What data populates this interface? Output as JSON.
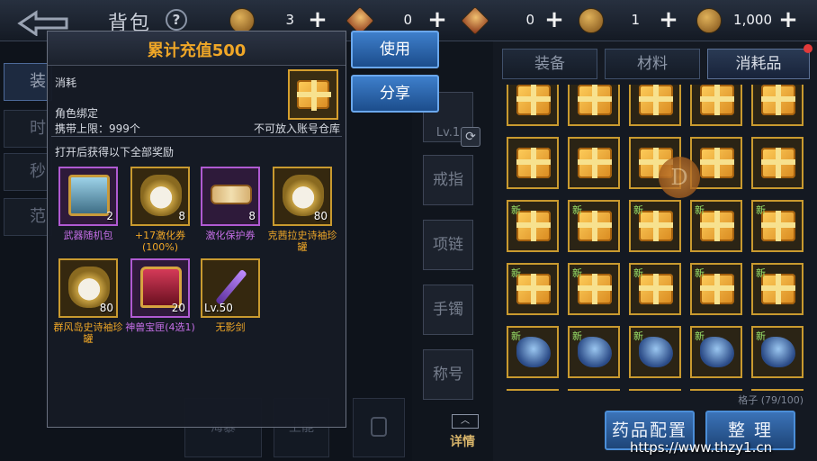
{
  "header": {
    "title": "背包",
    "help": "?"
  },
  "currencies": [
    {
      "icon": "gold-coin-icon",
      "value": "3"
    },
    {
      "icon": "diamond-ticket-icon",
      "value": "0"
    },
    {
      "icon": "scroll-coupon-icon",
      "value": "0"
    },
    {
      "icon": "token-coin-icon",
      "value": "1"
    },
    {
      "icon": "bronze-coin-icon",
      "value": "1,000"
    }
  ],
  "plus": "+",
  "side_tabs": [
    "装",
    "时",
    "秒",
    "范"
  ],
  "inventory": {
    "tabs": [
      "装备",
      "材料",
      "消耗品"
    ],
    "active_tab": "消耗品",
    "capacity": "格子 (79/100)",
    "new_badge": "新",
    "coin_letter": "D",
    "buttons": {
      "medicine": "药品配置",
      "sort": "整 理"
    }
  },
  "equip_slots": [
    "Lv.1",
    "戒指",
    "项链",
    "手镯",
    "称号"
  ],
  "detail_label": "详情",
  "bottom_dim": [
    "海暴",
    "上能",
    ""
  ],
  "actions": {
    "use": "使用",
    "share": "分享"
  },
  "tooltip": {
    "title": "累计充值500",
    "category": "消耗",
    "bind": "角色绑定",
    "stack_limit": "携带上限：999个",
    "warehouse": "不可放入账号仓库",
    "rewards_header": "打开后获得以下全部奖励",
    "rewards": [
      {
        "name": "武器随机包",
        "count": "2",
        "name_color": "#c46ee6",
        "rarity": "purple",
        "art": "chest"
      },
      {
        "name": "+17激化券(100%)",
        "count": "8",
        "name_color": "#f0a727",
        "rarity": "gold",
        "art": "jar"
      },
      {
        "name": "激化保护券",
        "count": "8",
        "name_color": "#c46ee6",
        "rarity": "purple",
        "art": "scroll"
      },
      {
        "name": "克茜拉史诗袖珍罐",
        "count": "80",
        "name_color": "#f0a727",
        "rarity": "gold",
        "art": "jar"
      },
      {
        "name": "群风岛史诗袖珍罐",
        "count": "80",
        "name_color": "#f0a727",
        "rarity": "gold",
        "art": "jar"
      },
      {
        "name": "神兽宝匣(4选1)",
        "count": "20",
        "name_color": "#c46ee6",
        "rarity": "purple",
        "art": "redchest"
      },
      {
        "name": "无影剑",
        "level": "Lv.50",
        "name_color": "#f0a727",
        "rarity": "gold",
        "art": "sword"
      }
    ]
  },
  "watermark": "https://www.thzy1.cn"
}
